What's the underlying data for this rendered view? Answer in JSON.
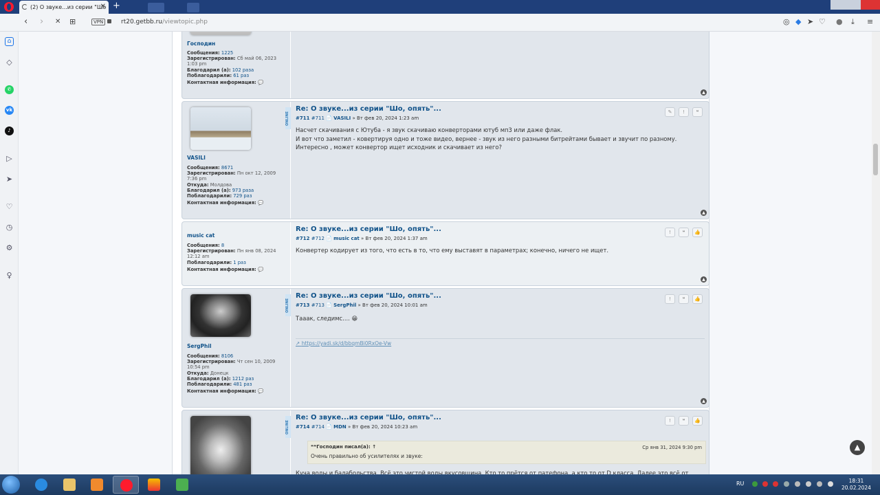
{
  "browser": {
    "tab_title": "(2) О звуке...из серии \"Шо",
    "tab_close": "✕",
    "new_tab": "+",
    "vpn_label": "VPN",
    "url_domain": "rt20.getbb.ru",
    "url_path": "/viewtopic.php"
  },
  "icons": {
    "back": "‹",
    "forward": "›",
    "reload": "✕",
    "tabs_grid": "⊞",
    "camera": "◎",
    "shield": "◆",
    "send": "➤",
    "heart": "♡",
    "account": "●",
    "download": "⤓",
    "menu": "≡"
  },
  "sidebar": {
    "items": [
      {
        "name": "home",
        "glyph": "⌂",
        "color": "#1a73e8"
      },
      {
        "name": "speed-dial",
        "glyph": "◇",
        "color": "#556"
      },
      {
        "name": "whatsapp",
        "glyph": "✆",
        "color": "#25d366"
      },
      {
        "name": "vk",
        "glyph": "vk",
        "color": "#2787f5"
      },
      {
        "name": "tiktok",
        "glyph": "♪",
        "color": "#111"
      },
      {
        "name": "player",
        "glyph": "▷",
        "color": "#556"
      },
      {
        "name": "send",
        "glyph": "➤",
        "color": "#556"
      },
      {
        "name": "favorites",
        "glyph": "♡",
        "color": "#556"
      },
      {
        "name": "history",
        "glyph": "◷",
        "color": "#556"
      },
      {
        "name": "settings",
        "glyph": "⚙",
        "color": "#556"
      },
      {
        "name": "tips",
        "glyph": "♀",
        "color": "#556"
      }
    ]
  },
  "labels": {
    "messages": "Сообщения:",
    "registered": "Зарегистрирован:",
    "location": "Откуда:",
    "thanked": "Благодарил (а):",
    "was_thanked": "Поблагодарили:",
    "contact": "Контактная информация:",
    "online": "ONLINE",
    "to_top": "▲",
    "btn_edit": "✎",
    "btn_report": "!",
    "btn_quote": "❝",
    "btn_like": "👍"
  },
  "posts": [
    {
      "username": "Господин",
      "messages": "1225",
      "registered": "Сб май 06, 2023 1:03 pm",
      "thanked": "102 раза",
      "was_thanked": "61 раз"
    },
    {
      "username": "VASILI",
      "messages": "8671",
      "registered": "Пн окт 12, 2009 7:36 pm",
      "location": "Молдова",
      "thanked": "973 раза",
      "was_thanked": "729 раз",
      "title": "Re: О звуке...из серии \"Шо, опять\"...",
      "num": "#711",
      "num2": "#711",
      "date": "» Вт фев 20, 2024 1:23 am",
      "text1": "Насчет скачивания с Ютуба - я звук скачиваю конверторами ютуб мп3 или даже флак.",
      "text2": "И вот что заметил - ковертируя одно и тоже видео, вернее - звук из него разными битрейтами бывает и звучит по разному.",
      "text3": "Интересно , может конвертор ищет исходник и скачивает из него?"
    },
    {
      "username": "music cat",
      "messages": "8",
      "registered": "Пн янв 08, 2024 12:12 am",
      "was_thanked": "1 раз",
      "title": "Re: О звуке...из серии \"Шо, опять\"...",
      "num": "#712",
      "num2": "#712",
      "date": "» Вт фев 20, 2024 1:37 am",
      "text1": "Конвертер кодирует из того, что есть в то, что ему выставят в параметрах; конечно, ничего не ищет."
    },
    {
      "username": "SergPhil",
      "messages": "8106",
      "registered": "Чт сен 10, 2009 10:54 pm",
      "location": "Донецк",
      "thanked": "1212 раз",
      "was_thanked": "481 раз",
      "title": "Re: О звуке...из серии \"Шо, опять\"...",
      "num": "#713",
      "num2": "#713",
      "date": "» Вт фев 20, 2024 10:01 am",
      "text1": "Тааак, следимс....",
      "smiley": "😁",
      "link": "https://yadi.sk/d/bbqmBi0RxOe-Vw"
    },
    {
      "username": "MDN",
      "title": "Re: О звуке...из серии \"Шо, опять\"...",
      "num": "#714",
      "num2": "#714",
      "date": "» Вт фев 20, 2024 10:23 am",
      "quote_author": "❝❝Господин писал(а): ↑",
      "quote_date": "Ср янв 31, 2024 9:30 pm",
      "quote_text": "Очень правильно об усилителях и звуке:",
      "text1": "Куча воды и балабольства. Всё это чистой воды вкусовщина. Кто то прётся от патефона, а кто то от D класса. Далее это всё от нечего делать"
    }
  ],
  "taskbar": {
    "lang": "RU",
    "time": "18:31",
    "date": "20.02.2024"
  }
}
